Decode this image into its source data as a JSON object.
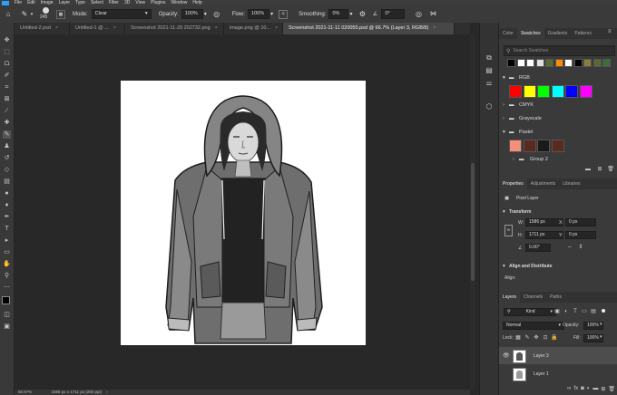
{
  "menu": {
    "items": [
      "File",
      "Edit",
      "Image",
      "Layer",
      "Type",
      "Select",
      "Filter",
      "3D",
      "View",
      "Plugins",
      "Window",
      "Help"
    ]
  },
  "options": {
    "brush_size": "245",
    "mode_label": "Mode:",
    "mode_value": "Clear",
    "opacity_label": "Opacity:",
    "opacity_value": "100%",
    "flow_label": "Flow:",
    "flow_value": "100%",
    "smoothing_label": "Smoothing:",
    "smoothing_value": "0%",
    "angle_value": "0°"
  },
  "tabs": [
    {
      "label": "Untitled-2.psd"
    },
    {
      "label": "Untitled-1 @ ..."
    },
    {
      "label": "Screenshot 2021-11-29 202732.png"
    },
    {
      "label": "image.png @ 10..."
    },
    {
      "label": "Screenshot 2021-11-11 020055.psd @ 66.7% (Layer 3, RGB/8)"
    }
  ],
  "status": {
    "zoom": "66.67%",
    "dimensions": "1586 px x 1711 px (250 ppi)"
  },
  "swatches_panel": {
    "tabs": [
      "Color",
      "Swatches",
      "Gradients",
      "Patterns"
    ],
    "search_placeholder": "Search Swatches",
    "recent_colors": [
      "#000000",
      "#ffffff",
      "#ffffff",
      "#e0e0e0",
      "#556b2f",
      "#ff8c00",
      "#ffffff",
      "#000000",
      "#8b7d3a",
      "#556b2f",
      "#3c6e3c"
    ],
    "groups": [
      {
        "name": "RGB",
        "colors": [
          "#ff0000",
          "#ffff00",
          "#00ff00",
          "#00ffff",
          "#0000ff",
          "#ff00ff"
        ]
      },
      {
        "name": "CMYK"
      },
      {
        "name": "Grayscale"
      },
      {
        "name": "Pastel",
        "colors": [
          "#f4907a",
          "#5a2a1e",
          "#1a1a1a",
          "#5a2a1e"
        ]
      },
      {
        "name": "Group 2"
      }
    ]
  },
  "properties_panel": {
    "tabs": [
      "Properties",
      "Adjustments",
      "Libraries"
    ],
    "layer_type": "Pixel Layer",
    "transform_heading": "Transform",
    "w_label": "W:",
    "w_value": "1586 px",
    "h_label": "H:",
    "h_value": "1711 px",
    "x_label": "X:",
    "x_value": "0 px",
    "y_label": "Y:",
    "y_value": "0 px",
    "angle_value": "0.00°",
    "align_heading": "Align and Distribute",
    "align_label": "Align:"
  },
  "layers_panel": {
    "tabs": [
      "Layers",
      "Channels",
      "Paths"
    ],
    "filter_value": "Kind",
    "blend_mode": "Normal",
    "opacity_label": "Opacity:",
    "opacity_value": "100%",
    "lock_label": "Lock:",
    "fill_label": "Fill:",
    "fill_value": "100%",
    "layers": [
      {
        "name": "Layer 3",
        "visible": true,
        "selected": true
      },
      {
        "name": "Layer 1",
        "visible": false,
        "selected": false
      }
    ]
  }
}
